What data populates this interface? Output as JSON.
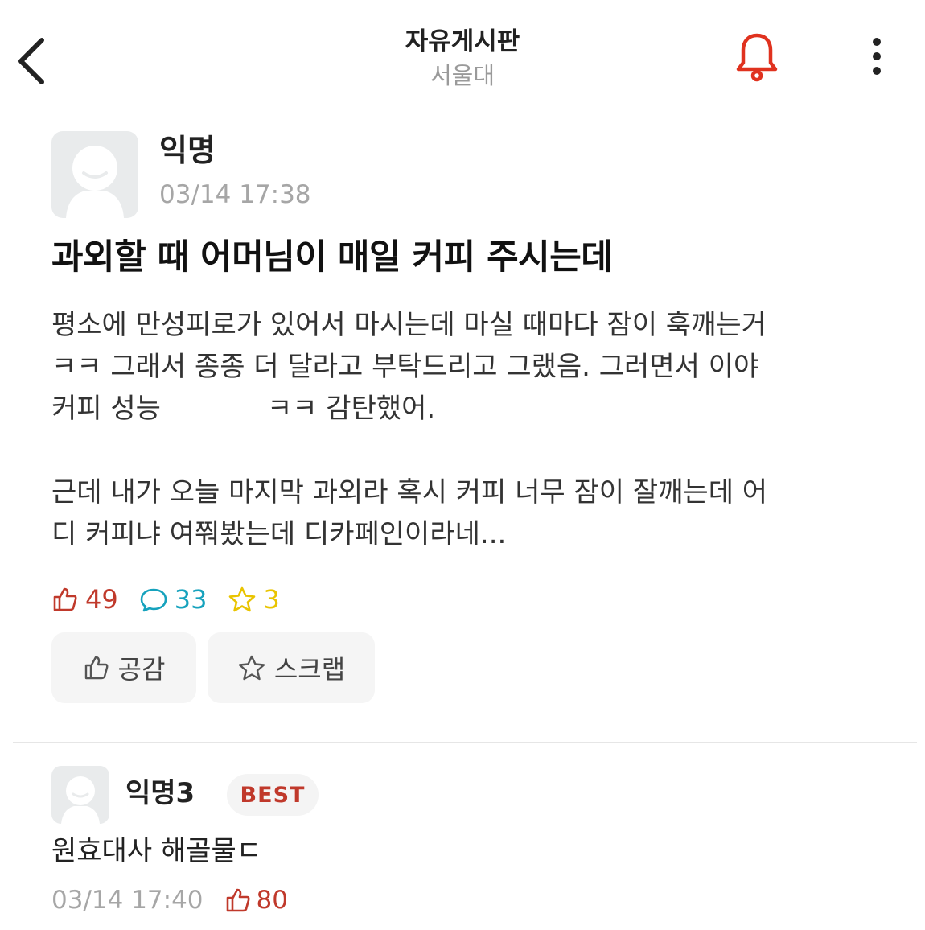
{
  "header": {
    "title": "자유게시판",
    "subtitle": "서울대",
    "icons": {
      "back": "chevron-left-icon",
      "bell": "bell-icon",
      "more": "more-vertical-icon"
    },
    "bell_color": "#e0321f"
  },
  "post": {
    "author": "익명",
    "time": "03/14 17:38",
    "title": "과외할 때 어머님이 매일 커피 주시는데",
    "body_lines": [
      "평소에 만성피로가 있어서 마시는데 마실 때마다 잠이 훅깨는거",
      "ㅋㅋ 그래서 종종 더 달라고 부탁드리고 그랬음. 그러면서 이야",
      "커피 성능",
      "ㅋㅋ 감탄했어.",
      "근데 내가 오늘 마지막 과외라 혹시 커피 너무 잠이 잘깨는데 어",
      "디 커피냐 여쭤봤는데 디카페인이라네..."
    ],
    "stats": {
      "likes": "49",
      "comments": "33",
      "scraps": "3"
    },
    "actions": {
      "like_label": "공감",
      "scrap_label": "스크랩"
    }
  },
  "comment": {
    "author": "익명3",
    "badge": "BEST",
    "text": "원효대사 해골물ㄷ",
    "time": "03/14 17:40",
    "likes": "80"
  },
  "colors": {
    "like": "#c0392b",
    "comment": "#16a2bd",
    "scrap": "#e9c400",
    "muted": "#a6a6a6"
  }
}
